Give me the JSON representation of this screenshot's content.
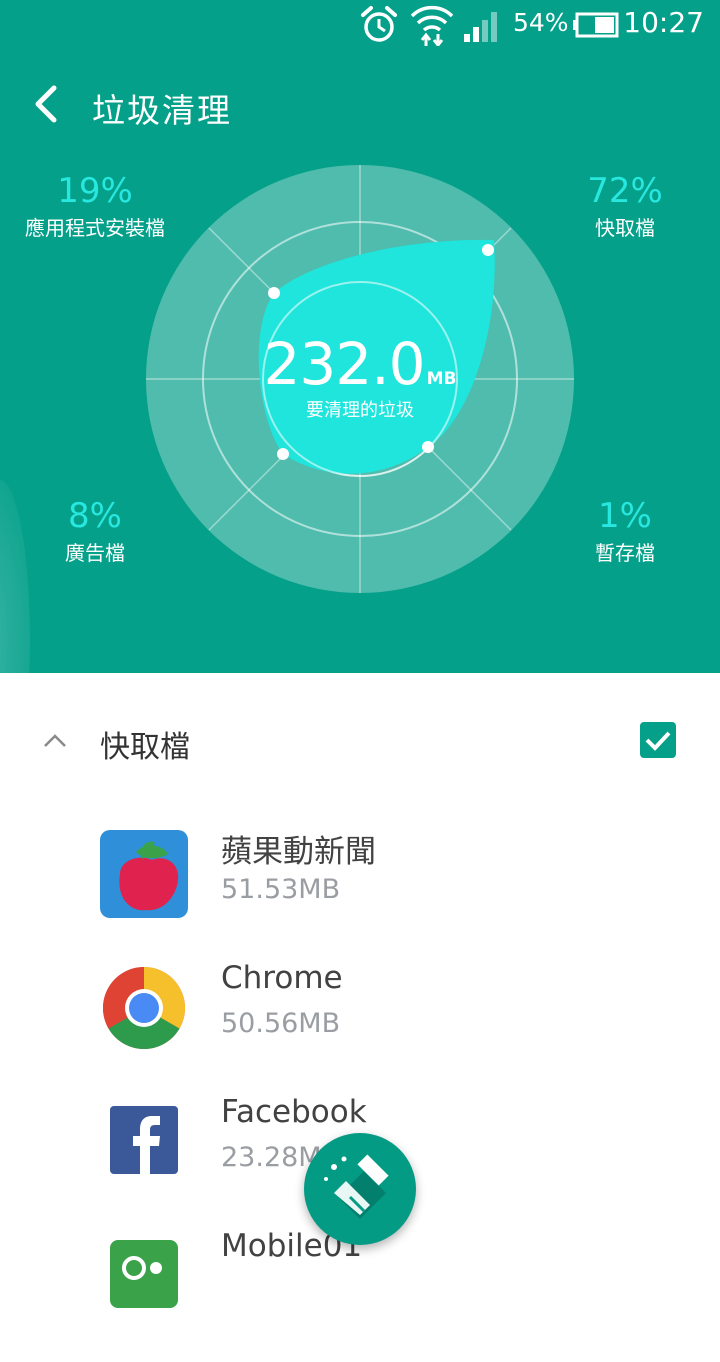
{
  "status_bar": {
    "battery": "54%",
    "time": "10:27"
  },
  "header": {
    "title": "垃圾清理"
  },
  "summary": {
    "total": "232.0",
    "unit": "MB",
    "label": "要清理的垃圾"
  },
  "categories": [
    {
      "pct": "19%",
      "label": "應用程式安裝檔"
    },
    {
      "pct": "72%",
      "label": "快取檔"
    },
    {
      "pct": "8%",
      "label": "廣告檔"
    },
    {
      "pct": "1%",
      "label": "暫存檔"
    }
  ],
  "section": {
    "title": "快取檔",
    "checked": true
  },
  "apps": [
    {
      "name": "蘋果動新聞",
      "size": "51.53MB"
    },
    {
      "name": "Chrome",
      "size": "50.56MB"
    },
    {
      "name": "Facebook",
      "size": "23.28MB"
    },
    {
      "name": "Mobile01",
      "size": ""
    }
  ],
  "colors": {
    "primary": "#04a08a",
    "accent": "#27e7df",
    "blob": "#1fe5dc"
  }
}
